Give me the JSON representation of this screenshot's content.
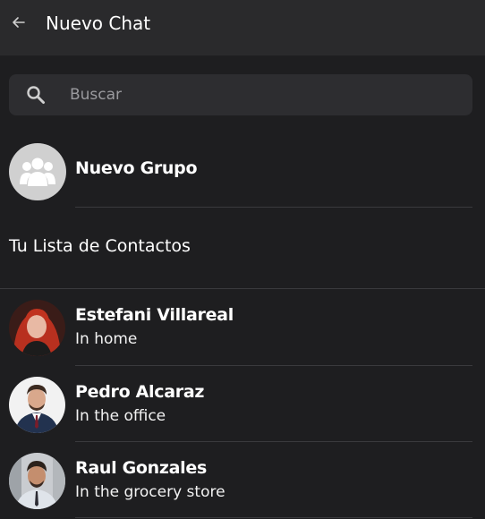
{
  "header": {
    "title": "Nuevo Chat",
    "back_icon": "arrow-left-icon"
  },
  "search": {
    "placeholder": "Buscar",
    "value": "",
    "icon": "search-icon"
  },
  "new_group": {
    "label": "Nuevo Grupo",
    "icon": "group-icon"
  },
  "contacts_section": {
    "title": "Tu Lista de Contactos"
  },
  "contacts": [
    {
      "name": "Estefani Villareal",
      "status": "In home"
    },
    {
      "name": "Pedro Alcaraz",
      "status": "In the office"
    },
    {
      "name": "Raul Gonzales",
      "status": "In the grocery store"
    }
  ],
  "colors": {
    "background": "#1e1e20",
    "header": "#2a2a2c",
    "search_bg": "#2d2d30",
    "divider": "#3a3a3d",
    "text": "#ffffff",
    "placeholder": "#9a9a9e"
  }
}
